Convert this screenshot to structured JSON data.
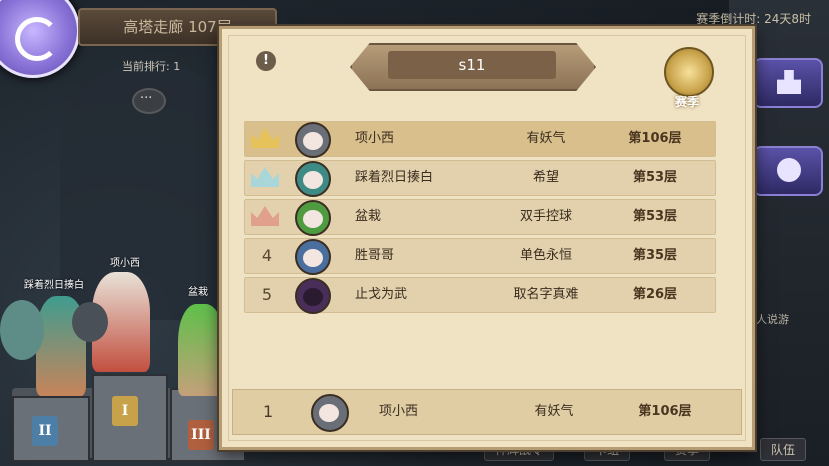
{
  "background": {
    "tower_title": "高塔走廊 107层",
    "rank_label": "当前排行: 1",
    "season_timer": "赛季倒计时: 24天8时",
    "right_caption": "人说游",
    "bottom_tabs": [
      "神辉战令",
      "卡组",
      "赛季",
      "队伍"
    ],
    "podium": {
      "char_names": {
        "first": "项小西",
        "second": "踩着烈日揍白",
        "third": "盆栽"
      },
      "places": [
        "II",
        "I",
        "III"
      ]
    }
  },
  "panel": {
    "season_label": "s11",
    "badge_label": "赛季",
    "alert_icon": "!",
    "rows": [
      {
        "place": "1",
        "crown": "gold-crown-icon",
        "name": "项小西",
        "guild": "有妖气",
        "floor": "第106层"
      },
      {
        "place": "2",
        "crown": "silver-crown-icon",
        "name": "踩着烈日揍白",
        "guild": "希望",
        "floor": "第53层"
      },
      {
        "place": "3",
        "crown": "bronze-crown-icon",
        "name": "盆栽",
        "guild": "双手控球",
        "floor": "第53层"
      },
      {
        "place": "4",
        "name": "胜哥哥",
        "guild": "单色永恒",
        "floor": "第35层"
      },
      {
        "place": "5",
        "name": "止戈为武",
        "guild": "取名字真难",
        "floor": "第26层"
      }
    ],
    "my_rank": {
      "place": "1",
      "name": "项小西",
      "guild": "有妖气",
      "floor": "第106层"
    }
  },
  "colors": {
    "panel_bg": "#efe3c4",
    "row_highlight": "#d9bf8c",
    "gold": "#e6c35a",
    "silver": "#a9d6d8",
    "bronze": "#e0a08c"
  }
}
